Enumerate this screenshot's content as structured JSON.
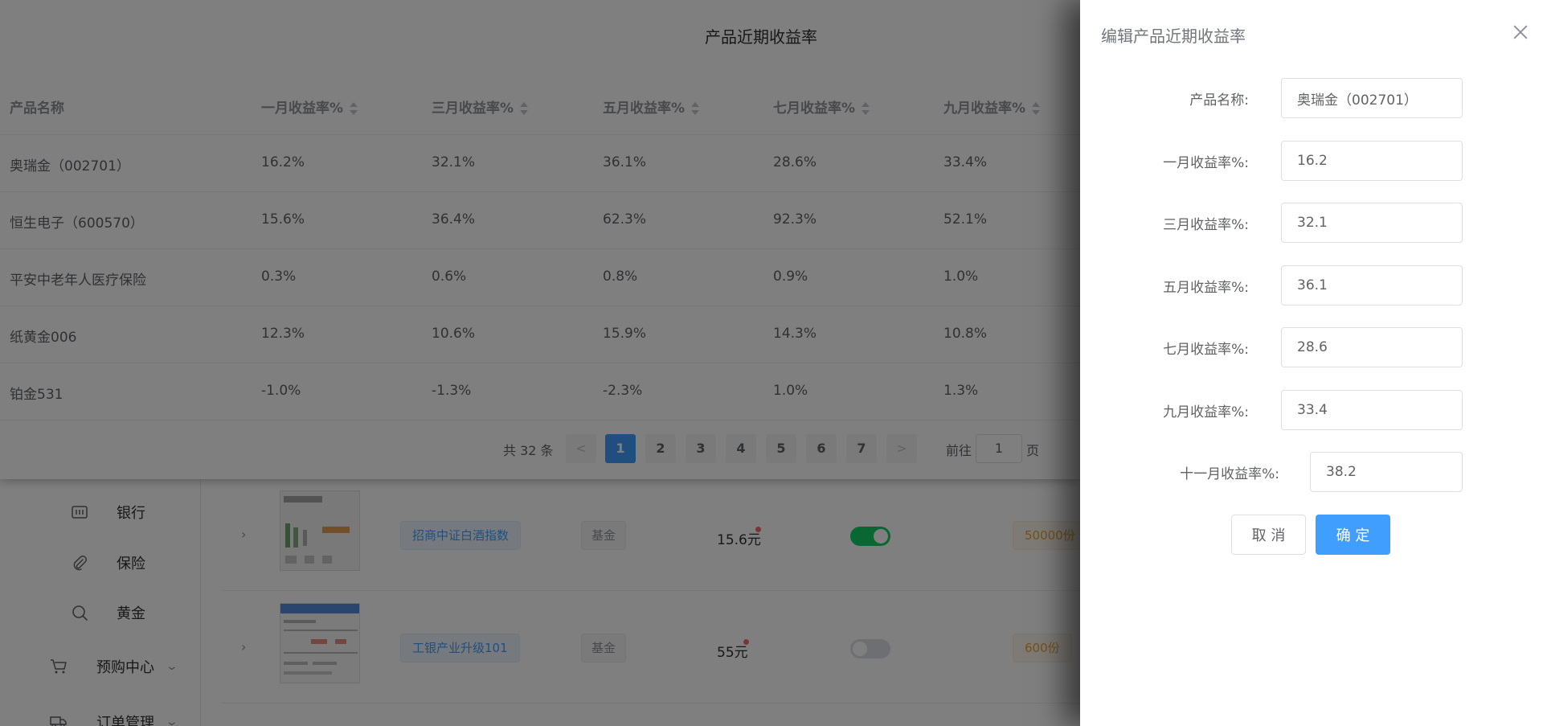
{
  "sidebar": {
    "items": [
      {
        "label": "银行",
        "icon": "bank-icon"
      },
      {
        "label": "保险",
        "icon": "paperclip-icon"
      },
      {
        "label": "黄金",
        "icon": "search-icon"
      },
      {
        "label": "预购中心",
        "icon": "cart-icon"
      },
      {
        "label": "订单管理",
        "icon": "truck-icon"
      }
    ]
  },
  "product_list": {
    "rows": [
      {
        "name": "招商中证白酒指数",
        "type": "基金",
        "price": "15.6元",
        "enabled": true,
        "stock": "50000份"
      },
      {
        "name": "工银产业升级101",
        "type": "基金",
        "price": "55元",
        "enabled": false,
        "stock": "600份"
      }
    ]
  },
  "returns_dialog": {
    "title": "产品近期收益率",
    "columns": [
      "产品名称",
      "一月收益率%",
      "三月收益率%",
      "五月收益率%",
      "七月收益率%",
      "九月收益率%"
    ],
    "rows": [
      [
        "奥瑞金（002701）",
        "16.2%",
        "32.1%",
        "36.1%",
        "28.6%",
        "33.4%"
      ],
      [
        "恒生电子（600570）",
        "15.6%",
        "36.4%",
        "62.3%",
        "92.3%",
        "52.1%"
      ],
      [
        "平安中老年人医疗保险",
        "0.3%",
        "0.6%",
        "0.8%",
        "0.9%",
        "1.0%"
      ],
      [
        "纸黄金006",
        "12.3%",
        "10.6%",
        "15.9%",
        "14.3%",
        "10.8%"
      ],
      [
        "铂金531",
        "-1.0%",
        "-1.3%",
        "-2.3%",
        "1.0%",
        "1.3%"
      ]
    ],
    "pagination": {
      "total": "共 32 条",
      "prev": "<",
      "next": ">",
      "pages": [
        "1",
        "2",
        "3",
        "4",
        "5",
        "6",
        "7"
      ],
      "current": "1",
      "goto_label": "前往",
      "goto_value": "1",
      "page_unit": "页"
    }
  },
  "drawer": {
    "title": "编辑产品近期收益率",
    "fields": [
      {
        "label": "产品名称:",
        "value": "奥瑞金（002701）"
      },
      {
        "label": "一月收益率%:",
        "value": "16.2"
      },
      {
        "label": "三月收益率%:",
        "value": "32.1"
      },
      {
        "label": "五月收益率%:",
        "value": "36.1"
      },
      {
        "label": "七月收益率%:",
        "value": "28.6"
      },
      {
        "label": "九月收益率%:",
        "value": "33.4"
      },
      {
        "label": "十一月收益率%:",
        "value": "38.2"
      }
    ],
    "cancel_label": "取 消",
    "confirm_label": "确 定"
  },
  "colors": {
    "primary": "#409eff",
    "switch_on": "#13ce66",
    "switch_off": "#dcdfe6",
    "overlay": "rgba(0,0,0,0.5)"
  }
}
